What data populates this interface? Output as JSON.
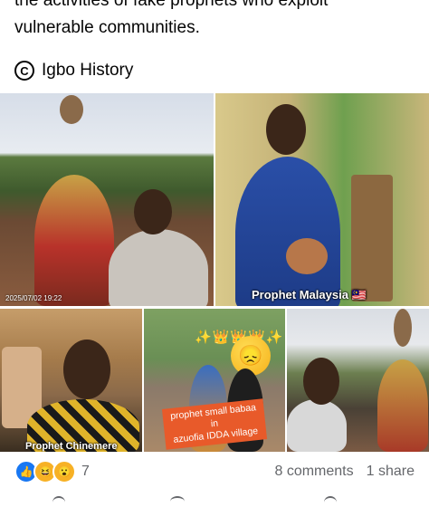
{
  "post": {
    "text_line1": "the activities of fake prophets who exploit",
    "text_line2": "vulnerable communities.",
    "source_label": "Igbo History"
  },
  "photos": {
    "photo1_timestamp": "2025/07/02 19:22",
    "photo2_caption": "Prophet Malaysia 🇲🇾",
    "photo3_caption": "Prophet Chinemere",
    "photo4_sticker_line1": "prophet small babaa in",
    "photo4_sticker_line2": "azuofia IDDA village",
    "photo4_emoji": "😞",
    "photo4_crowns": "✨👑👑👑✨"
  },
  "engagement": {
    "reaction_icons": [
      "like-icon",
      "haha-icon",
      "wow-icon"
    ],
    "reaction_glyphs": [
      "👍",
      "😆",
      "😮"
    ],
    "reaction_count": "7",
    "comments_label": "8 comments",
    "shares_label": "1 share"
  },
  "colors": {
    "text_primary": "#050505",
    "text_secondary": "#65676b",
    "like_blue": "#1877f2",
    "sticker_orange": "#e85a2a"
  }
}
